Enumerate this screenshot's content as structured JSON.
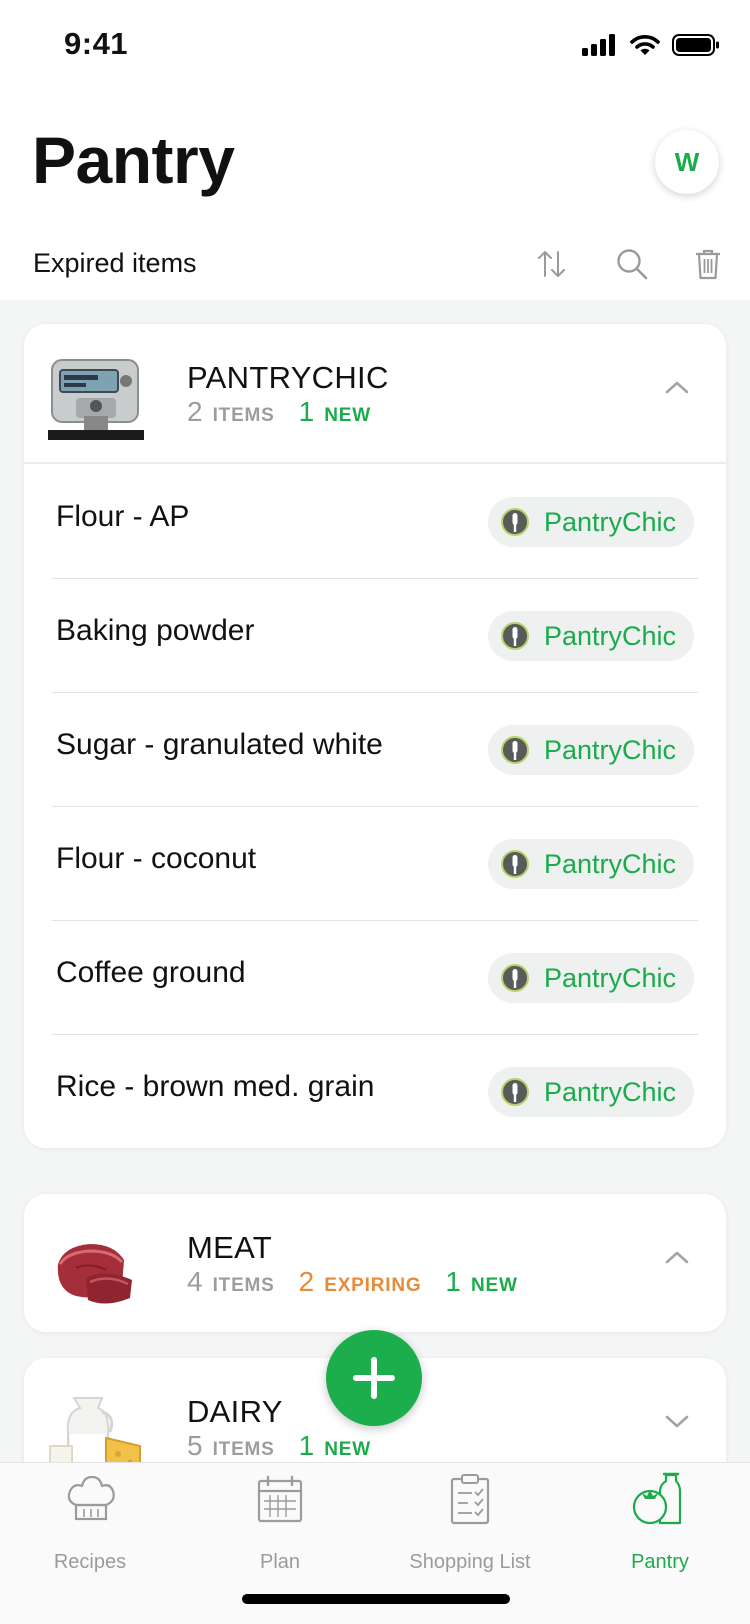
{
  "status_bar": {
    "time": "9:41"
  },
  "header": {
    "title": "Pantry",
    "avatar_initial": "W"
  },
  "toolbar": {
    "filter_label": "Expired items"
  },
  "sections": [
    {
      "name": "PANTRYCHIC",
      "items_count": "2",
      "items_word": "ITEMS",
      "new_count": "1",
      "new_word": "NEW",
      "expanded": true,
      "items": [
        {
          "name": "Flour - AP",
          "source": "PantryChic"
        },
        {
          "name": "Baking powder",
          "source": "PantryChic"
        },
        {
          "name": "Sugar - granulated white",
          "source": "PantryChic"
        },
        {
          "name": "Flour - coconut",
          "source": "PantryChic"
        },
        {
          "name": "Coffee ground",
          "source": "PantryChic"
        },
        {
          "name": "Rice - brown med. grain",
          "source": "PantryChic"
        }
      ]
    },
    {
      "name": "MEAT",
      "items_count": "4",
      "items_word": "ITEMS",
      "expiring_count": "2",
      "expiring_word": "EXPIRING",
      "new_count": "1",
      "new_word": "NEW",
      "expanded": false
    },
    {
      "name": "DAIRY",
      "items_count": "5",
      "items_word": "ITEMS",
      "new_count": "1",
      "new_word": "NEW",
      "expanded": false
    }
  ],
  "tabbar": {
    "tabs": [
      {
        "label": "Recipes",
        "icon": "chef-hat-icon",
        "active": false
      },
      {
        "label": "Plan",
        "icon": "calendar-icon",
        "active": false
      },
      {
        "label": "Shopping  List",
        "icon": "clipboard-list-icon",
        "active": false
      },
      {
        "label": "Pantry",
        "icon": "pantry-tomato-bottle-icon",
        "active": true
      }
    ]
  },
  "colors": {
    "accent_green": "#1cab4c",
    "expiring_orange": "#e68a3b",
    "muted_gray": "#9d9d9d"
  }
}
